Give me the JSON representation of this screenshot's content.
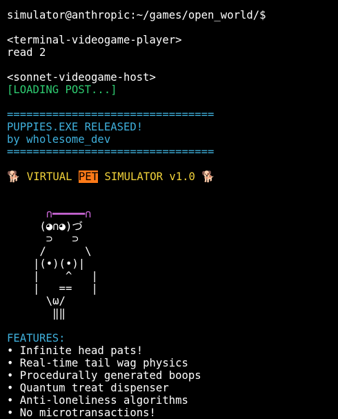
{
  "prompt": "simulator@anthropic:~/games/open_world/$",
  "player_tag": "<terminal-videogame-player>",
  "player_command": "read 2",
  "host_tag": "<sonnet-videogame-host>",
  "loading": "[LOADING POST...]",
  "divider": "================================",
  "release_title": "PUPPIES.EXE RELEASED!",
  "release_author": "by wholesome_dev",
  "game_title": {
    "left_icon": "🐕",
    "part1": " VIRTUAL ",
    "highlight": "PET",
    "part2": " SIMULATOR v1.0 ",
    "right_icon": "🐕"
  },
  "ascii_art": {
    "ears": "  ∩━━━━━∩",
    "lines": [
      " (◕∩◕)づ",
      "  ⊃   ⊃",
      " /      \\",
      "|(•)(•)|",
      "|    ^   |",
      "|   ==   |",
      "  \\ω/",
      "   ‖‖"
    ]
  },
  "features_header": "FEATURES:",
  "features": [
    "• Infinite head pats!",
    "• Real-time tail wag physics",
    "• Procedurally generated boops",
    "• Quantum treat dispenser",
    "• Anti-loneliness algorithms",
    "• No microtransactions!"
  ],
  "colors": {
    "background": "#000000",
    "text": "#ffffff",
    "loading": "#2ecc71",
    "release": "#3fb0dc",
    "title": "#f1d23a",
    "highlight": "#ff7a18",
    "ears": "#d36be0"
  }
}
